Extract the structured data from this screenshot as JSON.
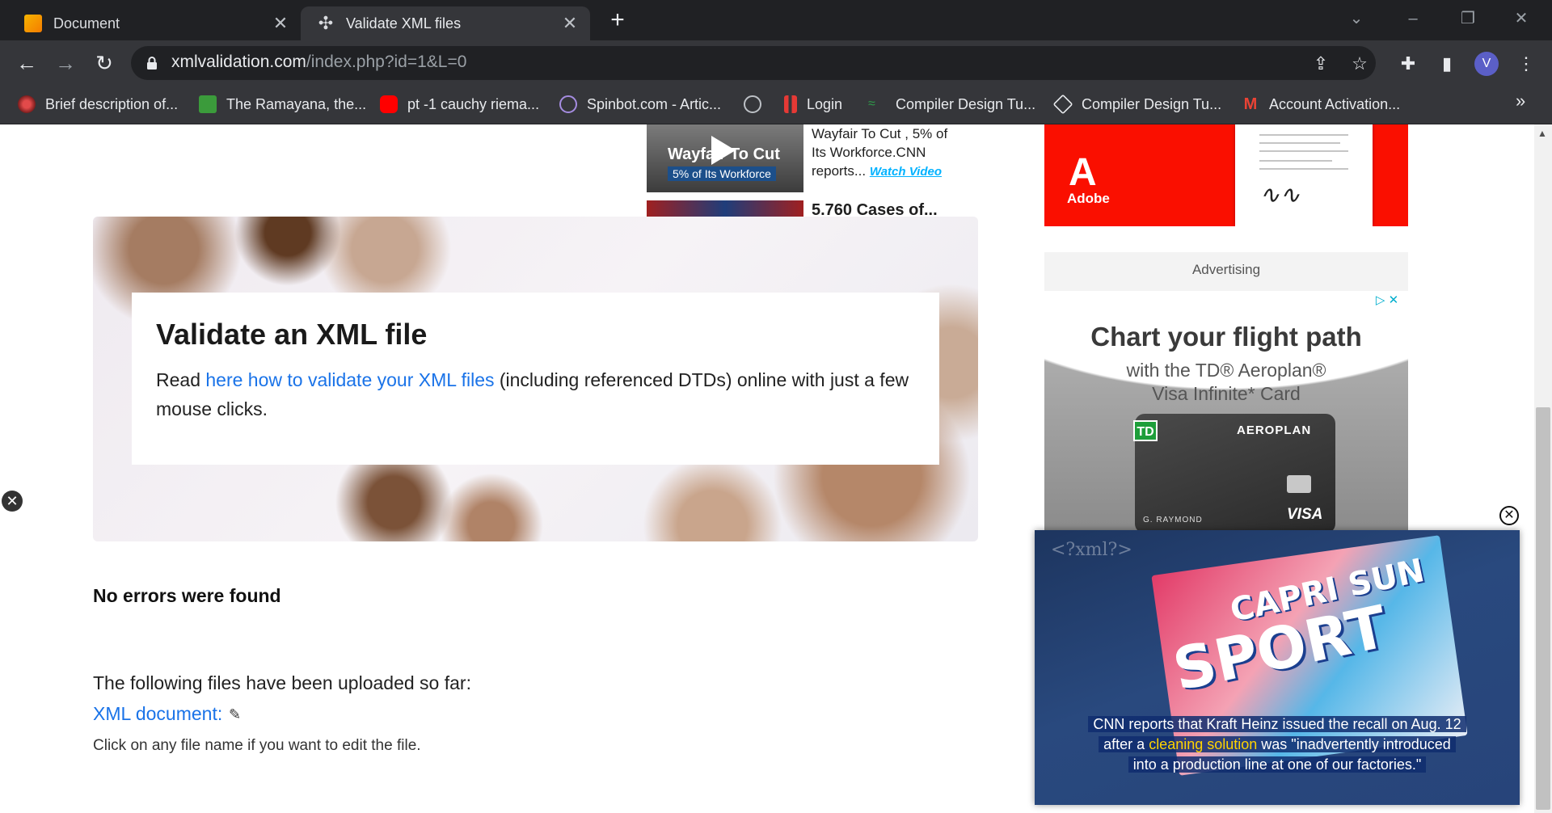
{
  "browser": {
    "tabs": [
      {
        "title": "Document",
        "active": false,
        "icon": "document-favicon"
      },
      {
        "title": "Validate XML files",
        "active": true,
        "icon": "xml-validation-favicon"
      }
    ],
    "new_tab": "+",
    "url_host": "xmlvalidation.com",
    "url_path": "/index.php?id=1&L=0",
    "profile_initial": "V",
    "bookmarks": [
      {
        "label": "Brief description of...",
        "icon": "flower-icon"
      },
      {
        "label": "The Ramayana, the...",
        "icon": "site-icon"
      },
      {
        "label": "pt -1 cauchy riema...",
        "icon": "youtube-icon"
      },
      {
        "label": "Spinbot.com - Artic...",
        "icon": "spinbot-icon"
      },
      {
        "label": "",
        "icon": "globe-icon"
      },
      {
        "label": "Login",
        "icon": "login-icon"
      },
      {
        "label": "Compiler Design Tu...",
        "icon": "compiler-icon"
      },
      {
        "label": "Compiler Design Tu...",
        "icon": "compiler-icon-2"
      },
      {
        "label": "Account Activation...",
        "icon": "gmail-icon"
      }
    ],
    "bookmarks_more": "»"
  },
  "news": {
    "thumb_caption_1": "Wayfair To Cut",
    "thumb_caption_2": "5% of Its Workforce",
    "text": "Wayfair To Cut , 5% of Its Workforce.CNN reports...",
    "link": "Watch Video",
    "title2": "5.760 Cases of..."
  },
  "hero": {
    "title": "Validate an XML file",
    "text_before": "Read ",
    "link": "here how to validate your XML files",
    "text_after": " (including referenced DTDs) online with just a few mouse clicks."
  },
  "result": {
    "status": "No errors were found",
    "uploaded": "The following files have been uploaded so far:",
    "file_link": "XML document:",
    "hint": "Click on any file name if you want to edit the file."
  },
  "ads": {
    "adobe_logo": "A",
    "adobe_label": "Adobe",
    "advertising_label": "Advertising",
    "td_title": "Chart your flight path",
    "td_sub1": "with the TD® Aeroplan®",
    "td_sub2": "Visa Infinite* Card",
    "card_bank": "TD",
    "card_program": "AEROPLAN",
    "card_name": "G. RAYMOND",
    "card_network": "VISA",
    "ad_choices": "▷ ✕"
  },
  "video": {
    "bg_text": "<?xml?>",
    "brand": "CAPRI SUN",
    "product": "SPORT",
    "caption_1": "CNN reports that Kraft Heinz issued the recall on Aug. 12",
    "caption_2a": "after a ",
    "caption_2b": "cleaning solution",
    "caption_2c": " was \"inadvertently introduced",
    "caption_3": "into a production line at one of our factories.\""
  }
}
